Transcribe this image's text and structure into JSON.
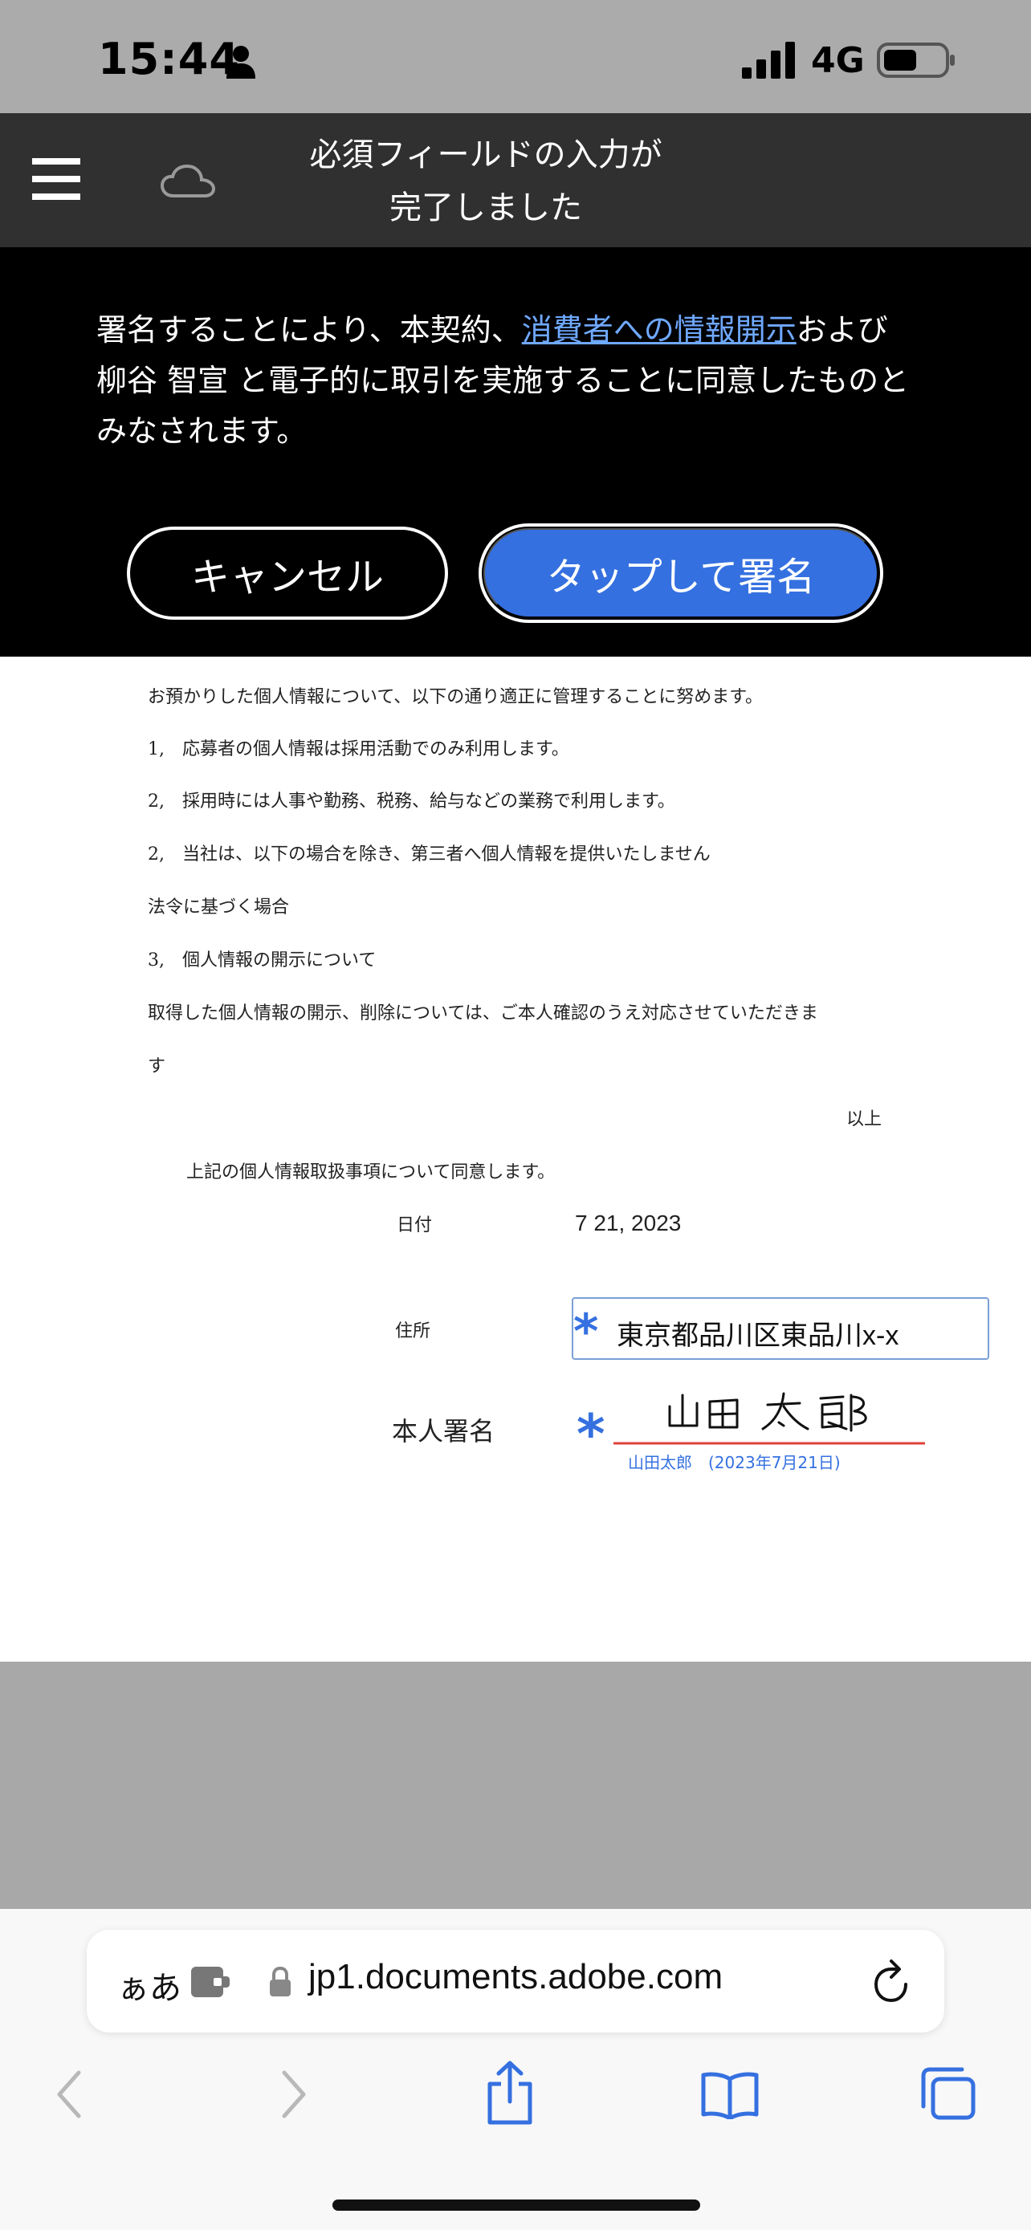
{
  "status_bar": {
    "time": "15:44",
    "network": "4G",
    "icons": [
      "person-icon",
      "signal-icon",
      "battery-icon"
    ]
  },
  "header": {
    "title_line1": "必須フィールドの入力が",
    "title_line2": "完了しました",
    "icons": [
      "menu-icon",
      "cloud-icon"
    ]
  },
  "consent": {
    "text_before_link": "署名することにより、本契約、",
    "link_text": "消費者への情報開示",
    "text_after_link_line1": "および",
    "text_line2": "柳谷 智宣 と電子的に取引を実施することに同意したものと",
    "text_line3": "みなされます。",
    "cancel_label": "キャンセル",
    "sign_label": "タップして署名",
    "link_color": "#6fa8ff",
    "accent_color": "#3570e0"
  },
  "document": {
    "lines": [
      "お預かりした個人情報について、以下の通り適正に管理することに努めます。",
      "1,　応募者の個人情報は採用活動でのみ利用します。",
      "2,　採用時には人事や勤務、税務、給与などの業務で利用します。",
      "2,　当社は、以下の場合を除き、第三者へ個人情報を提供いたしません",
      "法令に基づく場合",
      "3,　個人情報の開示について",
      "取得した個人情報の開示、削除については、ご本人確認のうえ対応させていただきま",
      "す"
    ],
    "closing": "以上",
    "agreement": "上記の個人情報取扱事項について同意します。",
    "date_label": "日付",
    "date_value": "7 21, 2023",
    "address_label": "住所",
    "address_value": "東京都品川区東品川x-x",
    "signature_label": "本人署名",
    "signature_caption": "山田太郎　(2023年7月21日)",
    "required_mark": "*"
  },
  "browser": {
    "aa_label": "ぁあ",
    "url": "jp1.documents.adobe.com",
    "icons": [
      "extension-icon",
      "lock-icon",
      "reload-icon",
      "back-icon",
      "forward-icon",
      "share-icon",
      "bookmarks-icon",
      "tabs-icon"
    ]
  }
}
